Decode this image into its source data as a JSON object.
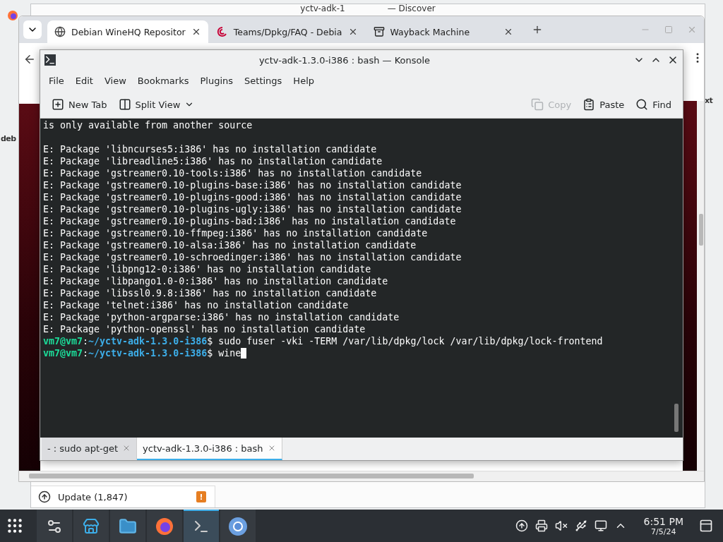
{
  "back_window": {
    "title_start": "yctv-adk-1",
    "title_end": "— Discover",
    "update": {
      "label": "Update (1,847)",
      "badge": "!"
    }
  },
  "browser": {
    "tabs": [
      {
        "label": "Debian WineHQ Repositor",
        "selected": true,
        "kind": "globe"
      },
      {
        "label": "Teams/Dpkg/FAQ - Debia",
        "selected": false,
        "kind": "debian"
      },
      {
        "label": "Wayback Machine",
        "selected": false,
        "kind": "archive"
      }
    ],
    "side_text_left": "deb",
    "side_text_right": "xt"
  },
  "konsole": {
    "title": "yctv-adk-1.3.0-i386 : bash — Konsole",
    "menu": [
      "File",
      "Edit",
      "View",
      "Bookmarks",
      "Plugins",
      "Settings",
      "Help"
    ],
    "toolbar": [
      {
        "label": "New Tab",
        "kind": "newtab",
        "disabled": false
      },
      {
        "label": "Split View",
        "kind": "split",
        "disabled": false
      },
      {
        "label": "Copy",
        "kind": "copy",
        "disabled": true
      },
      {
        "label": "Paste",
        "kind": "paste",
        "disabled": false
      },
      {
        "label": "Find",
        "kind": "find",
        "disabled": false
      }
    ],
    "lines": [
      {
        "kind": "output",
        "text": "is only available from another source"
      },
      {
        "kind": "blank"
      },
      {
        "kind": "output",
        "text": "E: Package 'libncurses5:i386' has no installation candidate"
      },
      {
        "kind": "output",
        "text": "E: Package 'libreadline5:i386' has no installation candidate"
      },
      {
        "kind": "output",
        "text": "E: Package 'gstreamer0.10-tools:i386' has no installation candidate"
      },
      {
        "kind": "output",
        "text": "E: Package 'gstreamer0.10-plugins-base:i386' has no installation candidate"
      },
      {
        "kind": "output",
        "text": "E: Package 'gstreamer0.10-plugins-good:i386' has no installation candidate"
      },
      {
        "kind": "output",
        "text": "E: Package 'gstreamer0.10-plugins-ugly:i386' has no installation candidate"
      },
      {
        "kind": "output",
        "text": "E: Package 'gstreamer0.10-plugins-bad:i386' has no installation candidate"
      },
      {
        "kind": "output",
        "text": "E: Package 'gstreamer0.10-ffmpeg:i386' has no installation candidate"
      },
      {
        "kind": "output",
        "text": "E: Package 'gstreamer0.10-alsa:i386' has no installation candidate"
      },
      {
        "kind": "output",
        "text": "E: Package 'gstreamer0.10-schroedinger:i386' has no installation candidate"
      },
      {
        "kind": "output",
        "text": "E: Package 'libpng12-0:i386' has no installation candidate"
      },
      {
        "kind": "output",
        "text": "E: Package 'libpango1.0-0:i386' has no installation candidate"
      },
      {
        "kind": "output",
        "text": "E: Package 'libssl0.9.8:i386' has no installation candidate"
      },
      {
        "kind": "output",
        "text": "E: Package 'telnet:i386' has no installation candidate"
      },
      {
        "kind": "output",
        "text": "E: Package 'python-argparse:i386' has no installation candidate"
      },
      {
        "kind": "output",
        "text": "E: Package 'python-openssl' has no installation candidate"
      },
      {
        "kind": "prompt",
        "user": "vm7@vm7",
        "sep": ":",
        "path": "~/yctv-adk-1.3.0-i386",
        "sign": "$",
        "command": "sudo fuser -vki -TERM /var/lib/dpkg/lock /var/lib/dpkg/lock-frontend",
        "cursor": false
      },
      {
        "kind": "prompt",
        "user": "vm7@vm7",
        "sep": ":",
        "path": "~/yctv-adk-1.3.0-i386",
        "sign": "$",
        "command": "wine",
        "cursor": true
      }
    ],
    "tabs": [
      {
        "label": "- : sudo apt-get",
        "selected": false
      },
      {
        "label": "yctv-adk-1.3.0-i386 : bash",
        "selected": true
      }
    ]
  },
  "taskbar": {
    "tasks": [
      {
        "kind": "settings",
        "selected": false
      },
      {
        "kind": "store",
        "selected": false
      },
      {
        "kind": "files",
        "selected": false
      },
      {
        "kind": "firefox",
        "selected": false
      },
      {
        "kind": "terminal",
        "selected": true
      },
      {
        "kind": "chromium",
        "selected": false
      }
    ],
    "time": "6:51 PM",
    "date": "7/5/24"
  }
}
